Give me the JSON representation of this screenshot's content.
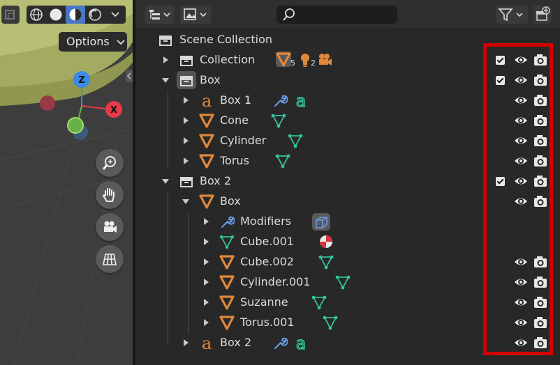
{
  "viewport": {
    "options_label": "Options",
    "gizmo": {
      "z": "Z",
      "x": "X"
    }
  },
  "outliner": {
    "scene_collection": "Scene Collection",
    "rows": [
      {
        "label": "Collection",
        "indent": 1,
        "expanded": false,
        "icon": "collection-icon",
        "badges": [
          {
            "icon": "mesh-icon",
            "count": "5"
          },
          {
            "icon": "light-icon",
            "count": "2"
          },
          {
            "icon": "camera-icon",
            "count": ""
          }
        ],
        "checkbox": true,
        "eye": true,
        "camera": true
      },
      {
        "label": "Box",
        "indent": 1,
        "expanded": true,
        "icon": "collection-icon",
        "checkbox": true,
        "eye": true,
        "camera": true
      },
      {
        "label": "Box 1",
        "indent": 2,
        "expanded": false,
        "icon": "text-object-icon",
        "checkbox": false,
        "eye": true,
        "camera": true
      },
      {
        "label": "Cone",
        "indent": 2,
        "expanded": false,
        "icon": "mesh-object-icon",
        "checkbox": false,
        "eye": true,
        "camera": true
      },
      {
        "label": "Cylinder",
        "indent": 2,
        "expanded": false,
        "icon": "mesh-object-icon",
        "checkbox": false,
        "eye": true,
        "camera": true
      },
      {
        "label": "Torus",
        "indent": 2,
        "expanded": false,
        "icon": "mesh-object-icon",
        "checkbox": false,
        "eye": true,
        "camera": true
      },
      {
        "label": "Box 2",
        "indent": 1,
        "expanded": true,
        "icon": "collection-icon",
        "checkbox": true,
        "eye": true,
        "camera": true
      },
      {
        "label": "Box",
        "indent": 2,
        "expanded": true,
        "icon": "mesh-object-icon",
        "checkbox": false,
        "eye": true,
        "camera": true
      },
      {
        "label": "Modifiers",
        "indent": 3,
        "expanded": false,
        "icon": "wrench-icon",
        "checkbox": false,
        "eye": false,
        "camera": false
      },
      {
        "label": "Cube.001",
        "indent": 3,
        "expanded": false,
        "icon": "mesh-data-icon",
        "checkbox": false,
        "eye": false,
        "camera": false
      },
      {
        "label": "Cube.002",
        "indent": 3,
        "expanded": false,
        "icon": "mesh-object-icon",
        "checkbox": false,
        "eye": true,
        "camera": true
      },
      {
        "label": "Cylinder.001",
        "indent": 3,
        "expanded": false,
        "icon": "mesh-object-icon",
        "checkbox": false,
        "eye": true,
        "camera": true
      },
      {
        "label": "Suzanne",
        "indent": 3,
        "expanded": false,
        "icon": "mesh-object-icon",
        "checkbox": false,
        "eye": true,
        "camera": true
      },
      {
        "label": "Torus.001",
        "indent": 3,
        "expanded": false,
        "icon": "mesh-object-icon",
        "checkbox": false,
        "eye": true,
        "camera": true
      },
      {
        "label": "Box 2",
        "indent": 2,
        "expanded": false,
        "icon": "text-object-icon",
        "checkbox": false,
        "eye": true,
        "camera": true
      }
    ]
  },
  "colors": {
    "object_orange": "#e0873c",
    "mesh_green": "#35c29c",
    "wrench_blue": "#6a9be6",
    "highlight_red": "#d40000"
  }
}
